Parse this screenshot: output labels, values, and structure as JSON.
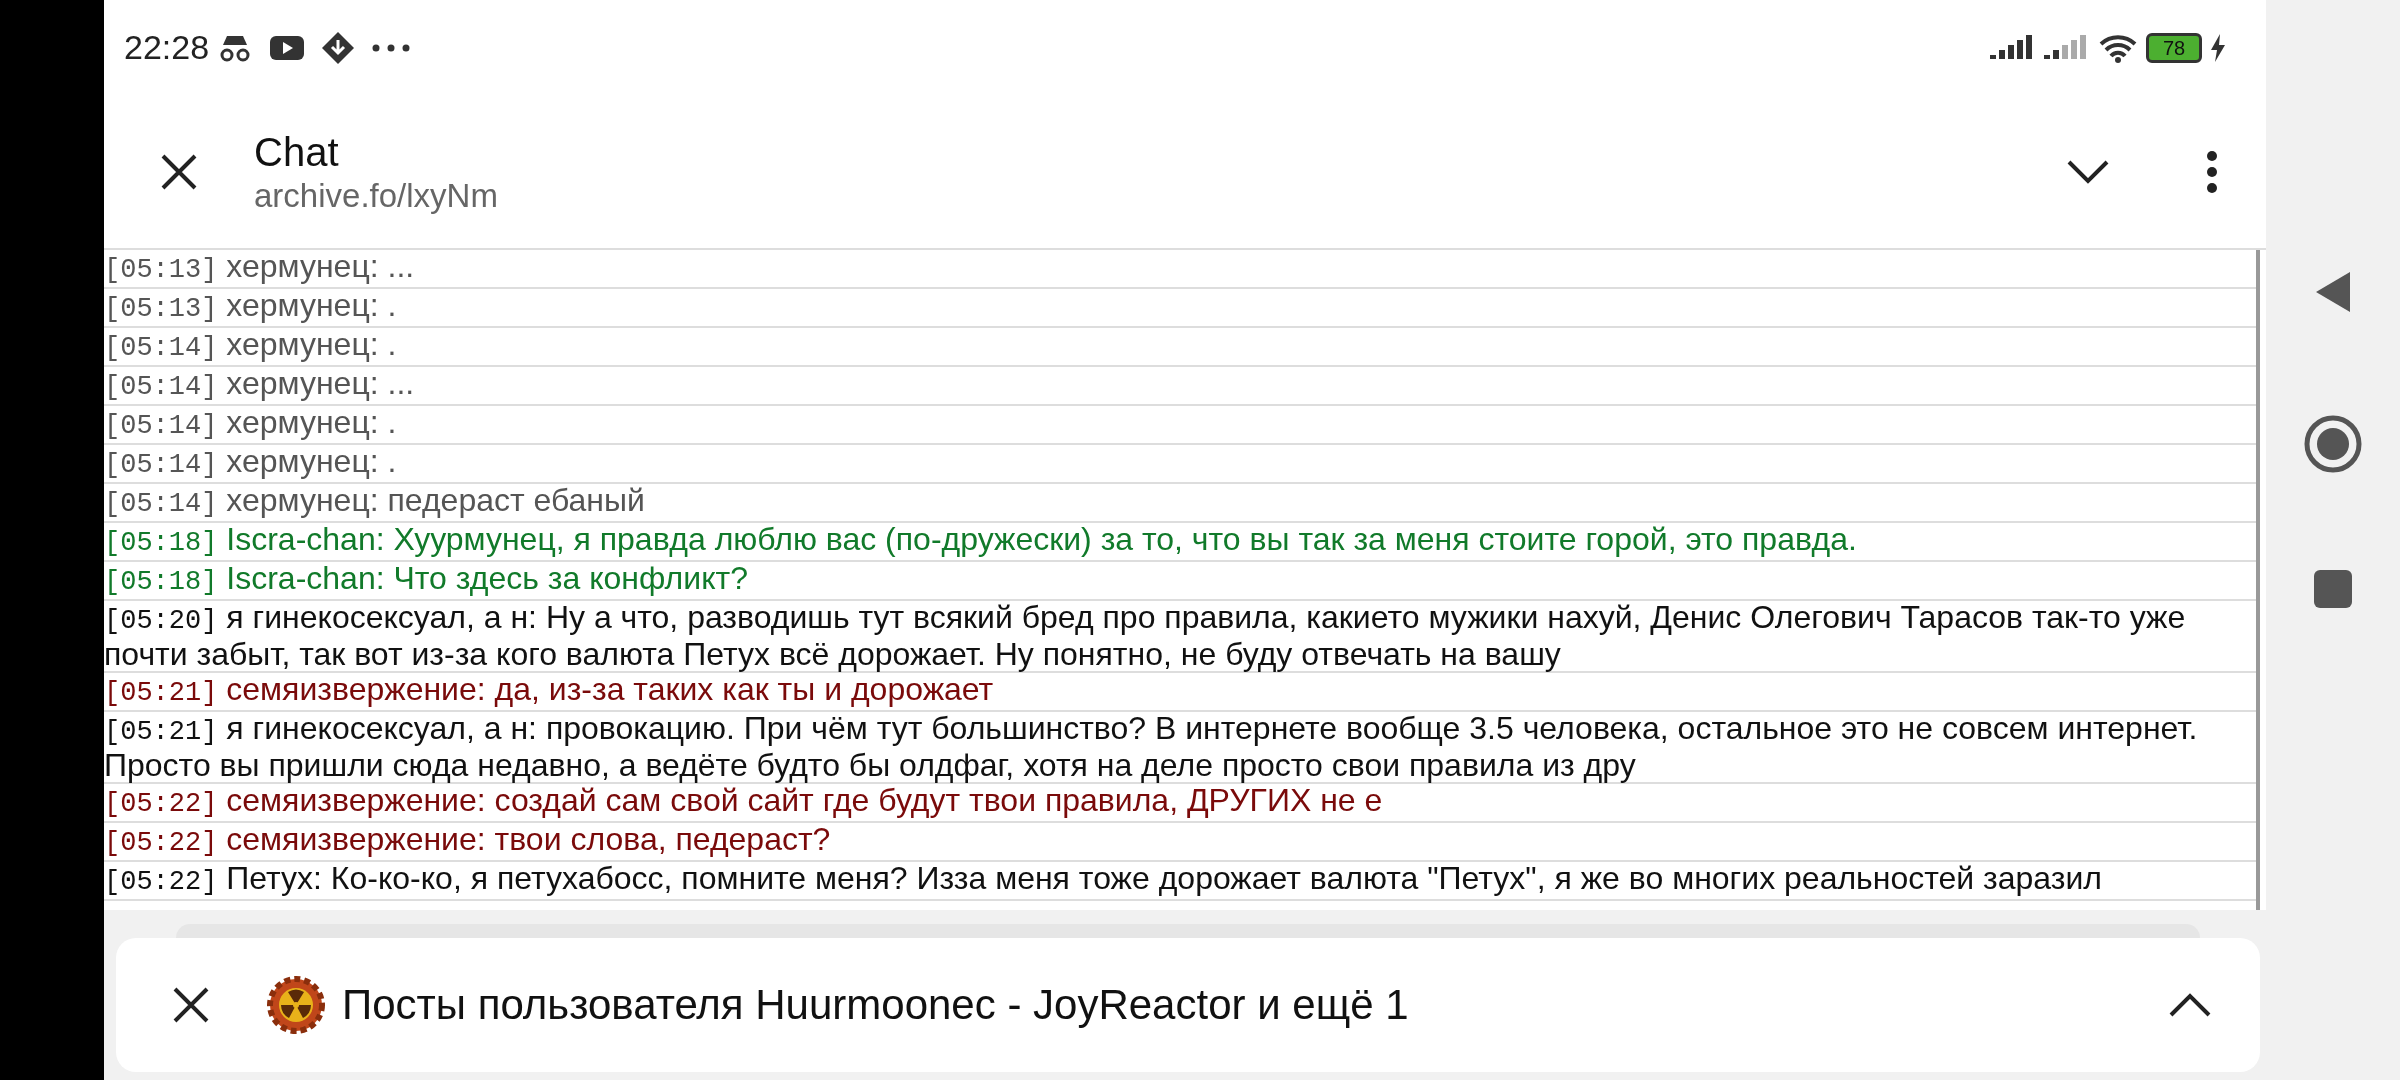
{
  "status_bar": {
    "time": "22:28",
    "battery": "78"
  },
  "header": {
    "title": "Chat",
    "url": "archive.fo/lxyNm"
  },
  "messages": [
    {
      "time": "[05:13]",
      "text": "хермунец: ...",
      "color": "#555555"
    },
    {
      "time": "[05:13]",
      "text": "хермунец: .",
      "color": "#555555"
    },
    {
      "time": "[05:14]",
      "text": "хермунец: .",
      "color": "#555555"
    },
    {
      "time": "[05:14]",
      "text": "хермунец: ...",
      "color": "#555555"
    },
    {
      "time": "[05:14]",
      "text": "хермунец: .",
      "color": "#555555"
    },
    {
      "time": "[05:14]",
      "text": "хермунец: .",
      "color": "#555555"
    },
    {
      "time": "[05:14]",
      "text": "хермунец: педераст ебаный",
      "color": "#555555"
    },
    {
      "time": "[05:18]",
      "text": "Iscra-chan: Хуурмунец, я правда люблю вас (по-дружески) за то, что вы так за меня стоите горой, это правда.",
      "color": "#117a2a"
    },
    {
      "time": "[05:18]",
      "text": "Iscra-chan: Что здесь за конфликт?",
      "color": "#117a2a"
    },
    {
      "time": "[05:20]",
      "text": "я гинекосексуал, а н: Ну а что, разводишь тут всякий бред про правила, какието мужики нахуй, Денис Олегович Тарасов так-то уже почти забыт, так вот из-за кого валюта Петух всё дорожает. Ну понятно, не буду отвечать на вашу",
      "color": "#111111"
    },
    {
      "time": "[05:21]",
      "text": "семяизвержение: да, из-за таких как ты и дорожает",
      "color": "#7a0a0a"
    },
    {
      "time": "[05:21]",
      "text": "я гинекосексуал, а н: провокацию. При чём тут большинство? В интернете вообще 3.5 человека, остальное это не совсем интернет. Просто вы пришли сюда недавно, а ведёте будто бы олдфаг, хотя на деле просто свои правила из дру",
      "color": "#111111"
    },
    {
      "time": "[05:22]",
      "text": "семяизвержение: создай сам свой сайт где будут твои правила, ДРУГИХ не е",
      "color": "#7a0a0a"
    },
    {
      "time": "[05:22]",
      "text": "семяизвержение: твои слова, педераст?",
      "color": "#7a0a0a"
    },
    {
      "time": "[05:22]",
      "text": "Петух: Ко-ко-ко, я петухабосс, помните меня? Изза меня тоже дорожает валюта \"Петух\", я же во многих реальностей заразил",
      "color": "#111111"
    }
  ],
  "bottom_tab": {
    "title": "Посты пользователя Huurmoonec - JoyReactor и ещё 1"
  }
}
